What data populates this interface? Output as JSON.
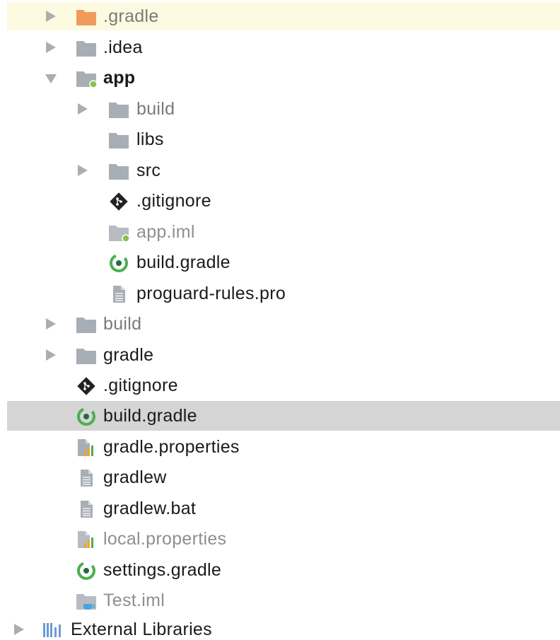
{
  "colors": {
    "text_normal": "#1a1a1a",
    "text_dim": "#7a7a7a",
    "text_faded": "#8f8f8f",
    "folder_gray": "#a8aeb5",
    "folder_orange": "#f09a5e",
    "module_green": "#8bc34a",
    "gradle_green": "#4caf50",
    "row_highlight_yellow": "#fcfae1",
    "row_selected": "#d5d5d5"
  },
  "tree": [
    {
      "label": ".gradle",
      "icon": "folder-orange-icon",
      "expander": "collapsed",
      "style": "dim"
    },
    {
      "label": ".idea",
      "icon": "folder-icon",
      "expander": "collapsed",
      "style": "normal"
    },
    {
      "label": "app",
      "icon": "module-folder-icon",
      "expander": "expanded",
      "style": "bold"
    },
    {
      "label": "build",
      "icon": "folder-icon",
      "expander": "collapsed",
      "style": "dim"
    },
    {
      "label": "libs",
      "icon": "folder-icon",
      "expander": "none",
      "style": "normal"
    },
    {
      "label": "src",
      "icon": "folder-icon",
      "expander": "collapsed",
      "style": "normal"
    },
    {
      "label": ".gitignore",
      "icon": "git-icon",
      "expander": "none",
      "style": "normal"
    },
    {
      "label": "app.iml",
      "icon": "module-file-icon",
      "expander": "none",
      "style": "faded"
    },
    {
      "label": "build.gradle",
      "icon": "gradle-icon",
      "expander": "none",
      "style": "normal"
    },
    {
      "label": "proguard-rules.pro",
      "icon": "text-file-icon",
      "expander": "none",
      "style": "normal"
    },
    {
      "label": "build",
      "icon": "folder-icon",
      "expander": "collapsed",
      "style": "dim"
    },
    {
      "label": "gradle",
      "icon": "folder-icon",
      "expander": "collapsed",
      "style": "normal"
    },
    {
      "label": ".gitignore",
      "icon": "git-icon",
      "expander": "none",
      "style": "normal"
    },
    {
      "label": "build.gradle",
      "icon": "gradle-icon",
      "expander": "none",
      "style": "normal",
      "selected": true
    },
    {
      "label": "gradle.properties",
      "icon": "properties-file-icon",
      "expander": "none",
      "style": "normal"
    },
    {
      "label": "gradlew",
      "icon": "text-file-icon",
      "expander": "none",
      "style": "normal"
    },
    {
      "label": "gradlew.bat",
      "icon": "text-file-icon",
      "expander": "none",
      "style": "normal"
    },
    {
      "label": "local.properties",
      "icon": "properties-file-icon",
      "expander": "none",
      "style": "faded"
    },
    {
      "label": "settings.gradle",
      "icon": "gradle-icon",
      "expander": "none",
      "style": "normal"
    },
    {
      "label": "Test.iml",
      "icon": "java-module-file-icon",
      "expander": "none",
      "style": "faded"
    },
    {
      "label": "External Libraries",
      "icon": "libraries-icon",
      "expander": "collapsed",
      "style": "normal"
    }
  ]
}
